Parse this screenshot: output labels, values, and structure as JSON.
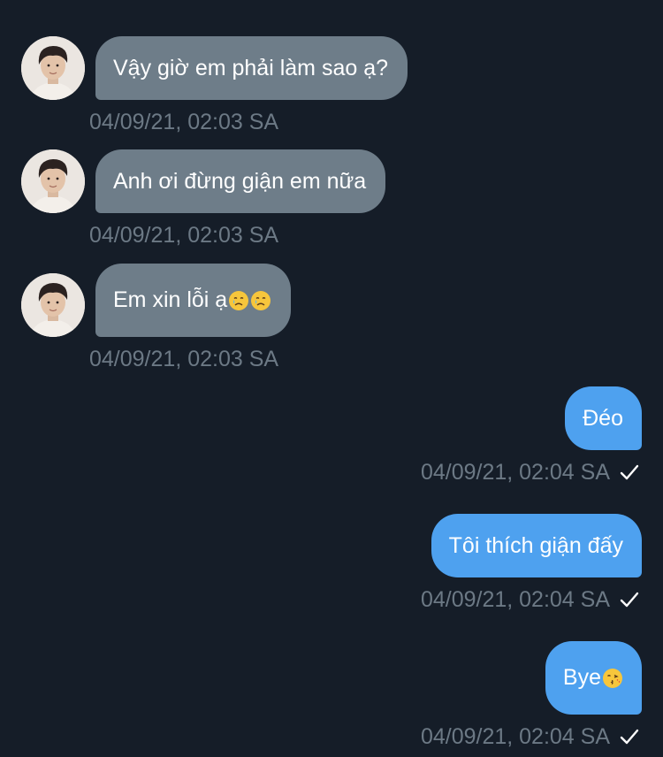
{
  "messages": [
    {
      "direction": "in",
      "text": "Vậy giờ em phải làm sao ạ?",
      "time": "04/09/21, 02:03 SA"
    },
    {
      "direction": "in",
      "text": "Anh ơi đừng giận em nữa",
      "time": "04/09/21, 02:03 SA"
    },
    {
      "direction": "in",
      "text": "Em xin lỗi ạ",
      "emoji": [
        "crying-face-icon",
        "crying-face-icon"
      ],
      "time": "04/09/21, 02:03 SA"
    },
    {
      "direction": "out",
      "text": "Đéo",
      "time": "04/09/21, 02:04 SA",
      "status": "sent"
    },
    {
      "direction": "out",
      "text": "Tôi thích giận đấy",
      "time": "04/09/21, 02:04 SA",
      "status": "sent"
    },
    {
      "direction": "out",
      "text": "Bye",
      "emoji": [
        "kissing-face-icon"
      ],
      "time": "04/09/21, 02:04 SA",
      "status": "sent"
    }
  ],
  "colors": {
    "background": "#151d28",
    "incoming_bubble": "#6e7d89",
    "outgoing_bubble": "#4ea1ef",
    "timestamp": "#6c7985"
  }
}
